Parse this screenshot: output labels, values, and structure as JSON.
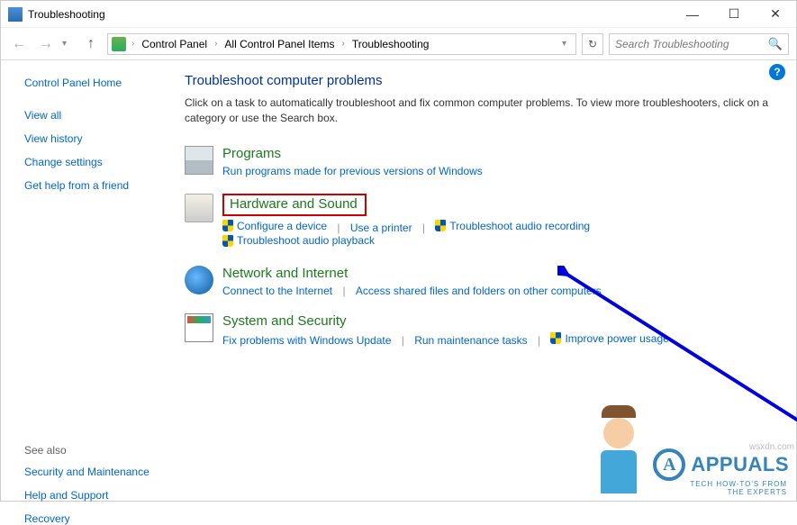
{
  "title": "Troubleshooting",
  "win": {
    "min": "—",
    "max": "☐",
    "close": "✕"
  },
  "nav": {
    "back": "←",
    "fwd": "→",
    "dd": "▾",
    "refresh": "↻"
  },
  "breadcrumb": {
    "sep": "›",
    "items": [
      "Control Panel",
      "All Control Panel Items",
      "Troubleshooting"
    ],
    "dd": "▾"
  },
  "search": {
    "placeholder": "Search Troubleshooting",
    "icon": "🔍"
  },
  "help": "?",
  "sidebar": {
    "home": "Control Panel Home",
    "links": [
      "View all",
      "View history",
      "Change settings",
      "Get help from a friend"
    ],
    "seealso_label": "See also",
    "seealso": [
      "Security and Maintenance",
      "Help and Support",
      "Recovery"
    ]
  },
  "page": {
    "heading": "Troubleshoot computer problems",
    "desc": "Click on a task to automatically troubleshoot and fix common computer problems. To view more troubleshooters, click on a category or use the Search box."
  },
  "cats": {
    "programs": {
      "title": "Programs",
      "subs": [
        "Run programs made for previous versions of Windows"
      ]
    },
    "hardware": {
      "title": "Hardware and Sound",
      "subs": [
        "Configure a device",
        "Use a printer",
        "Troubleshoot audio recording",
        "Troubleshoot audio playback"
      ]
    },
    "network": {
      "title": "Network and Internet",
      "subs": [
        "Connect to the Internet",
        "Access shared files and folders on other computers"
      ]
    },
    "system": {
      "title": "System and Security",
      "subs": [
        "Fix problems with Windows Update",
        "Run maintenance tasks",
        "Improve power usage"
      ]
    }
  },
  "watermark": {
    "brand": "APPUALS",
    "tag1": "TECH HOW-TO'S FROM",
    "tag2": "THE EXPERTS",
    "src": "wsxdn.com"
  }
}
